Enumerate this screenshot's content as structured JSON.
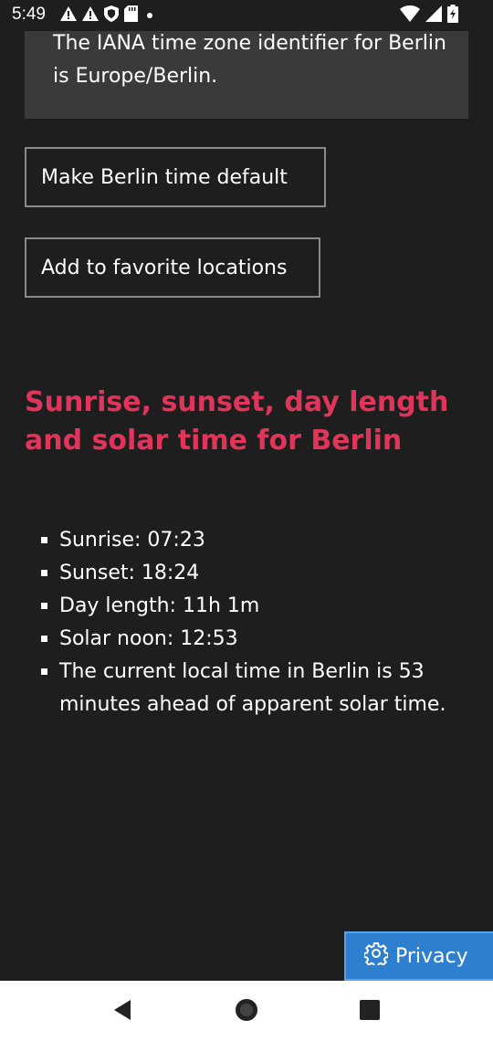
{
  "status_bar": {
    "time": "5:49"
  },
  "info_box": {
    "text": "The IANA time zone identifier for Berlin is Europe/Berlin."
  },
  "buttons": {
    "make_default": "Make Berlin time default",
    "add_favorite": "Add to favorite locations"
  },
  "solar_section": {
    "heading": "Sunrise, sunset, day length and solar time for Berlin",
    "items": [
      "Sunrise: 07:23",
      "Sunset: 18:24",
      "Day length: 11h 1m",
      "Solar noon: 12:53",
      "The current local time in Berlin is 53 minutes ahead of apparent solar time."
    ]
  },
  "privacy_button": {
    "label": "Privacy"
  },
  "colors": {
    "background": "#1e1e1e",
    "info_box": "#3a3a3a",
    "heading_accent": "#e0355a",
    "privacy_button": "#2f7fd1",
    "nav_bar": "#ffffff"
  },
  "icons": {
    "status_left": [
      "warning-icon",
      "warning-icon",
      "shield-icon",
      "sd-card-icon",
      "dot-icon"
    ],
    "status_right": [
      "wifi-icon",
      "signal-icon",
      "battery-icon"
    ],
    "privacy": "gear-icon",
    "nav": [
      "back-icon",
      "home-icon",
      "recents-icon"
    ]
  }
}
